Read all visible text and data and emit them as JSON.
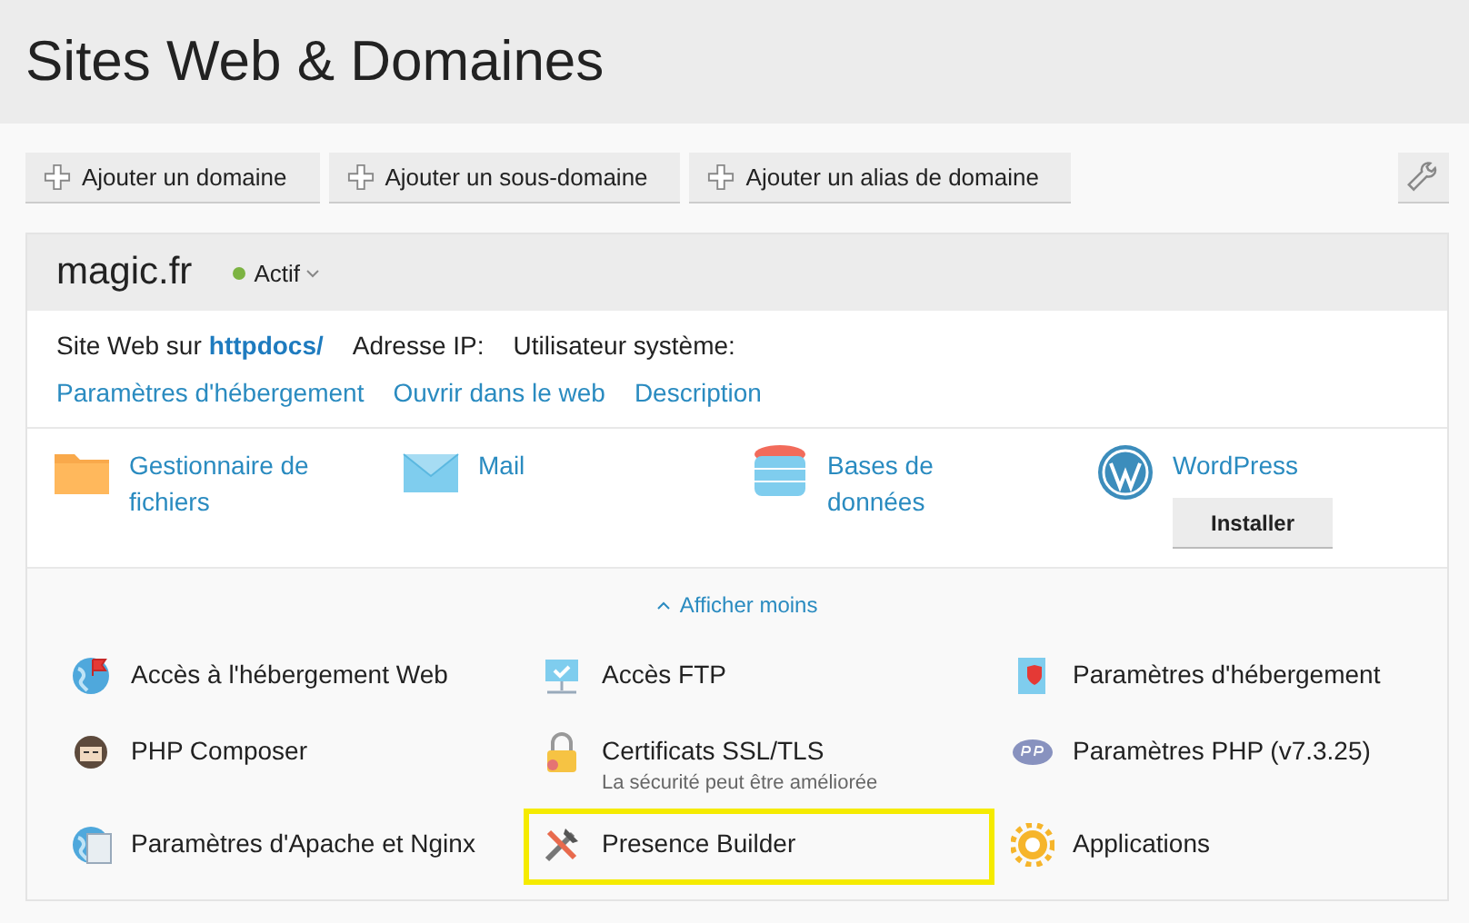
{
  "page_title": "Sites Web & Domaines",
  "toolbar": {
    "buttons": [
      "Ajouter un domaine",
      "Ajouter un sous-domaine",
      "Ajouter un alias de domaine"
    ]
  },
  "domain": {
    "name": "magic.fr",
    "status": {
      "label": "Actif",
      "color": "#7cb342"
    },
    "info": {
      "site_label": "Site Web sur",
      "site_path": "httpdocs/",
      "ip_label": "Adresse IP:",
      "user_label": "Utilisateur système:"
    },
    "links": [
      "Paramètres d'hébergement",
      "Ouvrir dans le web",
      "Description"
    ],
    "apps": [
      {
        "label": "Gestionnaire de fichiers"
      },
      {
        "label": "Mail"
      },
      {
        "label": "Bases de données"
      },
      {
        "label": "WordPress",
        "button": "Installer"
      }
    ],
    "toggle": "Afficher moins",
    "tools": [
      {
        "label": "Accès à l'hébergement Web",
        "highlighted": false
      },
      {
        "label": "Accès FTP",
        "highlighted": false
      },
      {
        "label": "Paramètres d'hébergement",
        "highlighted": false
      },
      {
        "label": "PHP Composer",
        "highlighted": false
      },
      {
        "label": "Certificats SSL/TLS",
        "note": "La sécurité peut être améliorée",
        "highlighted": false
      },
      {
        "label": "Paramètres PHP (v7.3.25)",
        "highlighted": false
      },
      {
        "label": "Paramètres d'Apache et Nginx",
        "highlighted": false
      },
      {
        "label": "Presence Builder",
        "highlighted": true
      },
      {
        "label": "Applications",
        "highlighted": false
      }
    ]
  }
}
